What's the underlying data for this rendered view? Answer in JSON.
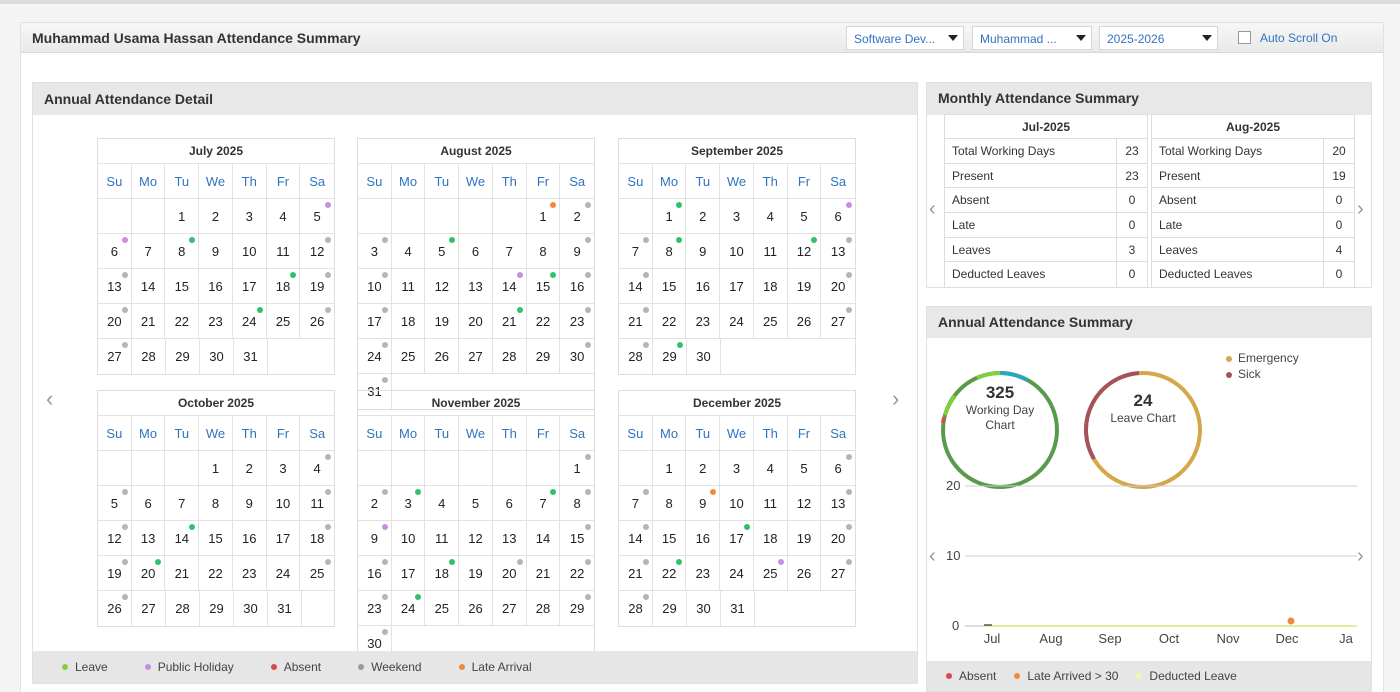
{
  "page": {
    "title": "Muhammad Usama Hassan Attendance Summary",
    "dept": "Software Dev...",
    "employee": "Muhammad ...",
    "year": "2025-2026",
    "autoscroll": "Auto Scroll On"
  },
  "annual_detail": {
    "title": "Annual Attendance Detail"
  },
  "weekdays": [
    "Su",
    "Mo",
    "Tu",
    "We",
    "Th",
    "Fr",
    "Sa"
  ],
  "colors": {
    "leave": "#2ec26a",
    "holiday": "#c98ee0",
    "absent": "#e04848",
    "weekend": "#b5b5b5",
    "late": "#f08a3a"
  },
  "months": [
    {
      "title": "July 2025",
      "start": 2,
      "days": 31,
      "marks": {
        "1": "",
        "5": "holiday",
        "6": "holiday",
        "8": "leave",
        "12": "weekend",
        "13": "weekend",
        "18": "leave",
        "19": "weekend",
        "20": "weekend",
        "24": "leave",
        "26": "weekend",
        "27": "weekend"
      }
    },
    {
      "title": "August 2025",
      "start": 5,
      "days": 31,
      "marks": {
        "1": "late",
        "2": "weekend",
        "3": "weekend",
        "5": "leave",
        "9": "weekend",
        "10": "weekend",
        "14": "holiday",
        "15": "leave",
        "16": "weekend",
        "17": "weekend",
        "21": "leave",
        "23": "weekend",
        "24": "weekend",
        "30": "weekend",
        "31": "weekend"
      }
    },
    {
      "title": "September 2025",
      "start": 1,
      "days": 30,
      "marks": {
        "1": "leave",
        "6": "holiday",
        "7": "weekend",
        "8": "leave",
        "12": "leave",
        "13": "weekend",
        "14": "weekend",
        "20": "weekend",
        "21": "weekend",
        "27": "weekend",
        "28": "weekend",
        "29": "leave"
      }
    },
    {
      "title": "October 2025",
      "start": 3,
      "days": 31,
      "marks": {
        "4": "weekend",
        "5": "weekend",
        "11": "weekend",
        "12": "weekend",
        "14": "leave",
        "18": "weekend",
        "19": "weekend",
        "20": "leave",
        "25": "weekend",
        "26": "weekend"
      }
    },
    {
      "title": "November 2025",
      "start": 6,
      "days": 30,
      "marks": {
        "1": "weekend",
        "2": "weekend",
        "3": "leave",
        "7": "leave",
        "8": "weekend",
        "9": "holiday",
        "15": "weekend",
        "16": "weekend",
        "18": "leave",
        "20": "weekend",
        "22": "weekend",
        "23": "weekend",
        "24": "leave",
        "29": "weekend",
        "30": "weekend"
      }
    },
    {
      "title": "December 2025",
      "start": 1,
      "days": 31,
      "marks": {
        "6": "weekend",
        "7": "weekend",
        "9": "late",
        "13": "weekend",
        "14": "weekend",
        "17": "leave",
        "20": "weekend",
        "21": "weekend",
        "22": "leave",
        "25": "holiday",
        "27": "weekend",
        "28": "weekend"
      }
    }
  ],
  "legend": [
    {
      "label": "Leave",
      "color": "#7fd13b"
    },
    {
      "label": "Public Holiday",
      "color": "#c98ee0"
    },
    {
      "label": "Absent",
      "color": "#e04848"
    },
    {
      "label": "Weekend",
      "color": "#9a9a9a"
    },
    {
      "label": "Late Arrival",
      "color": "#f08a3a"
    }
  ],
  "monthly": {
    "title": "Monthly Attendance Summary",
    "tables": [
      {
        "month": "Jul-2025",
        "rows": [
          [
            "Total Working Days",
            "23"
          ],
          [
            "Present",
            "23"
          ],
          [
            "Absent",
            "0"
          ],
          [
            "Late",
            "0"
          ],
          [
            "Leaves",
            "3"
          ],
          [
            "Deducted Leaves",
            "0"
          ]
        ]
      },
      {
        "month": "Aug-2025",
        "rows": [
          [
            "Total Working Days",
            "20"
          ],
          [
            "Present",
            "19"
          ],
          [
            "Absent",
            "0"
          ],
          [
            "Late",
            "0"
          ],
          [
            "Leaves",
            "4"
          ],
          [
            "Deducted Leaves",
            "0"
          ]
        ]
      }
    ]
  },
  "annual": {
    "title": "Annual Attendance Summary",
    "working": {
      "value": "325",
      "label": "Working Day Chart"
    },
    "leave": {
      "value": "24",
      "label": "Leave Chart"
    },
    "leave_legend": [
      {
        "label": "Emergency",
        "color": "#d4a84a"
      },
      {
        "label": "Sick",
        "color": "#a5525a"
      }
    ],
    "bottom_legend": [
      {
        "label": "Absent",
        "color": "#e04848"
      },
      {
        "label": "Late Arrived > 30",
        "color": "#f08a3a"
      },
      {
        "label": "Deducted Leave",
        "color": "#eef7b0"
      }
    ]
  },
  "chart_data": {
    "type": "line",
    "x": [
      "Jul",
      "Aug",
      "Sep",
      "Oct",
      "Nov",
      "Dec",
      "Ja"
    ],
    "yticks": [
      "20",
      "10",
      "0"
    ],
    "ylim": [
      0,
      20
    ],
    "series": [
      {
        "name": "Absent",
        "values": [
          0,
          0,
          0,
          0,
          0,
          0,
          0
        ]
      },
      {
        "name": "Late Arrived > 30",
        "values": [
          0,
          0,
          0,
          0,
          0,
          1,
          0
        ]
      },
      {
        "name": "Deducted Leave",
        "values": [
          0,
          0,
          0,
          0,
          0,
          0,
          0
        ]
      }
    ]
  }
}
